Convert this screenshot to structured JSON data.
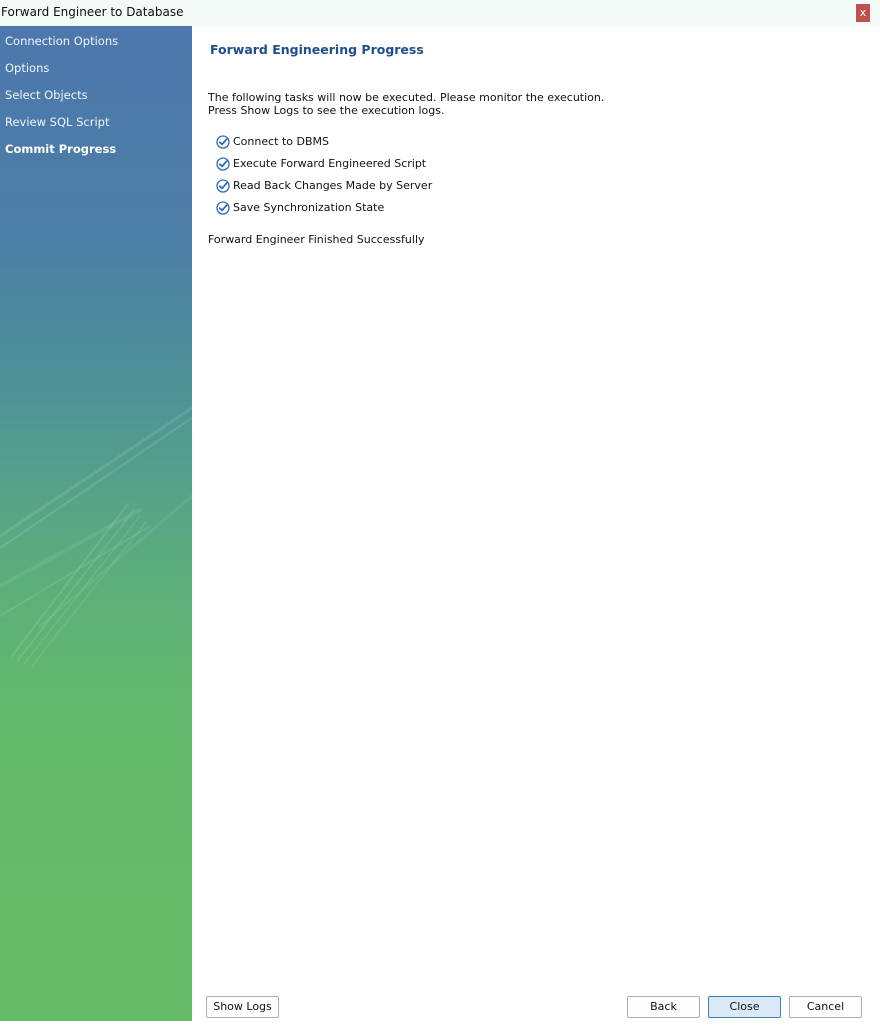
{
  "window": {
    "title": "Forward Engineer to Database",
    "close_glyph": "x"
  },
  "sidebar": {
    "items": [
      {
        "label": "Connection Options",
        "active": false
      },
      {
        "label": "Options",
        "active": false
      },
      {
        "label": "Select Objects",
        "active": false
      },
      {
        "label": "Review SQL Script",
        "active": false
      },
      {
        "label": "Commit Progress",
        "active": true
      }
    ]
  },
  "main": {
    "title": "Forward Engineering Progress",
    "intro_line1": "The following tasks will now be executed. Please monitor the execution.",
    "intro_line2": "Press Show Logs to see the execution logs.",
    "tasks": [
      {
        "label": "Connect to DBMS",
        "icon": "checkmark-icon"
      },
      {
        "label": "Execute Forward Engineered Script",
        "icon": "checkmark-icon"
      },
      {
        "label": "Read Back Changes Made by Server",
        "icon": "checkmark-icon"
      },
      {
        "label": "Save Synchronization State",
        "icon": "checkmark-icon"
      }
    ],
    "status": "Forward Engineer Finished Successfully"
  },
  "buttons": {
    "show_logs": "Show Logs",
    "back": "Back",
    "close": "Close",
    "cancel": "Cancel"
  },
  "colors": {
    "title_blue": "#1f4e8c",
    "check_blue": "#2b6bb8",
    "sidebar_top": "#4d77ad",
    "sidebar_bottom": "#66bc66",
    "close_red": "#c0504d"
  }
}
